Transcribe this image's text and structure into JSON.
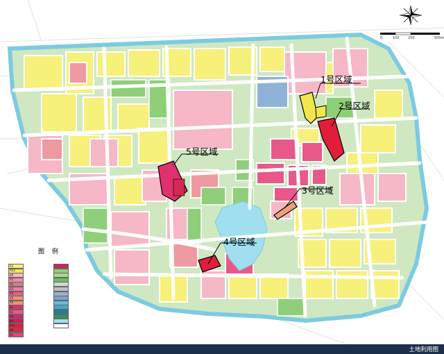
{
  "zones": [
    {
      "id": "zone-1",
      "label": "1号区域",
      "color": "#f2e64a"
    },
    {
      "id": "zone-2",
      "label": "2号区域",
      "color": "#e01e3c"
    },
    {
      "id": "zone-3",
      "label": "3号区域",
      "color": "#f0a07a"
    },
    {
      "id": "zone-4",
      "label": "4号区域",
      "color": "#e01e3c"
    },
    {
      "id": "zone-5",
      "label": "5号区域",
      "color": "#e0306e"
    }
  ],
  "legend": {
    "title": "图 例",
    "items_left": [
      {
        "code": "R2",
        "color": "#f7f07a",
        "text": ""
      },
      {
        "code": "R22",
        "color": "#f2e650",
        "text": ""
      },
      {
        "code": "B9",
        "color": "#f6b7c7",
        "text": ""
      },
      {
        "code": "A1",
        "color": "#ea8fa4",
        "text": ""
      },
      {
        "code": "A2",
        "color": "#d9788f",
        "text": ""
      },
      {
        "code": "A3",
        "color": "#f07aa6",
        "text": ""
      },
      {
        "code": "A4",
        "color": "#e2627c",
        "text": ""
      },
      {
        "code": "A5",
        "color": "#f28f80",
        "text": ""
      },
      {
        "code": "A6",
        "color": "#ef9370",
        "text": ""
      },
      {
        "code": "B1",
        "color": "#e0306e",
        "text": ""
      },
      {
        "code": "B2",
        "color": "#e85a8a",
        "text": ""
      },
      {
        "code": "B3",
        "color": "#d0286a",
        "text": ""
      },
      {
        "code": "B4",
        "color": "#c4205e",
        "text": ""
      },
      {
        "code": "B41",
        "color": "#e01e3c",
        "text": ""
      },
      {
        "code": "B9",
        "color": "#d42950",
        "text": ""
      },
      {
        "code": "Bx",
        "color": "#e04870",
        "text": ""
      }
    ],
    "items_right": [
      {
        "code": "",
        "color": "#c82855",
        "text": ""
      },
      {
        "code": "",
        "color": "#8fcf7a",
        "text": ""
      },
      {
        "code": "",
        "color": "#a8d98c",
        "text": ""
      },
      {
        "code": "",
        "color": "#6cbf5e",
        "text": ""
      },
      {
        "code": "",
        "color": "#d5d5d5",
        "text": ""
      },
      {
        "code": "",
        "color": "#bfbfbf",
        "text": ""
      },
      {
        "code": "",
        "color": "#9fb0c8",
        "text": ""
      },
      {
        "code": "",
        "color": "#7fa0c8",
        "text": ""
      },
      {
        "code": "",
        "color": "#5fbfd8",
        "text": ""
      },
      {
        "code": "",
        "color": "#44a8c8",
        "text": ""
      },
      {
        "code": "",
        "color": "#1f7f9a",
        "text": ""
      },
      {
        "code": "",
        "color": "#3a8f5a",
        "text": ""
      },
      {
        "code": "",
        "color": "#9fdff0",
        "text": ""
      },
      {
        "code": "",
        "color": "#ffffff",
        "text": ""
      }
    ]
  },
  "scale": {
    "label0": "0",
    "label1": "100",
    "label2": "250",
    "label3": "500m"
  },
  "footer": {
    "title": "土地利用图"
  },
  "colors": {
    "residential": "#f7f07a",
    "commercial": "#f6b7c7",
    "green": "#8fcf7a",
    "water": "#9fdff0",
    "road": "#ffffff",
    "background": "#d9d9d9"
  }
}
